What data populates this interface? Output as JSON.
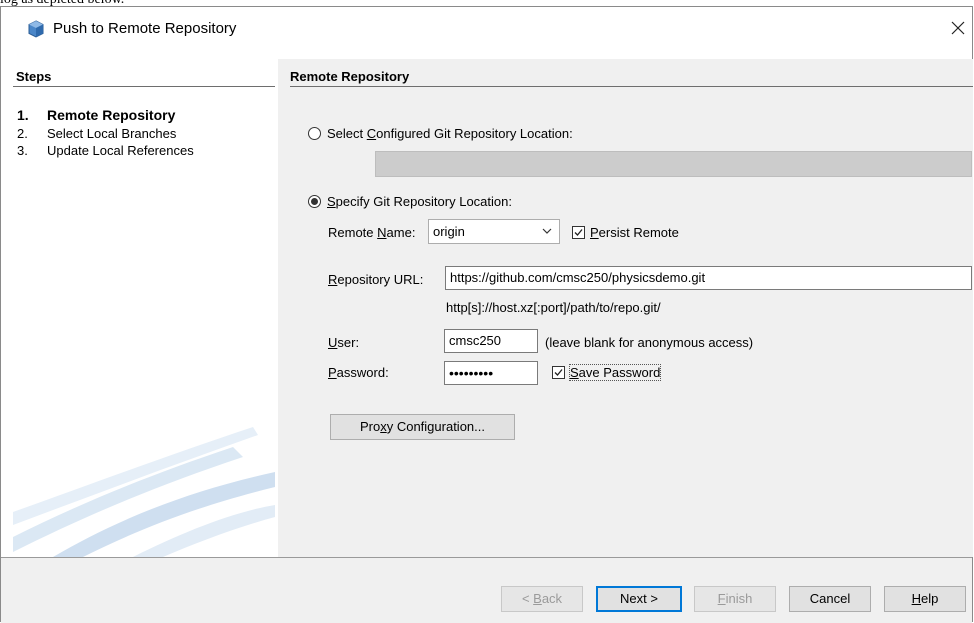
{
  "caption": "log as depicted below.",
  "window": {
    "title": "Push to Remote Repository",
    "close_glyph": "✕"
  },
  "steps": {
    "heading": "Steps",
    "items": [
      {
        "num": "1.",
        "label": "Remote Repository",
        "active": true
      },
      {
        "num": "2.",
        "label": "Select Local Branches",
        "active": false
      },
      {
        "num": "3.",
        "label": "Update Local References",
        "active": false
      }
    ]
  },
  "main": {
    "heading": "Remote Repository",
    "option_configured": {
      "pre": "Select ",
      "mnemonic": "C",
      "post": "onfigured Git Repository Location:",
      "checked": false
    },
    "option_specify": {
      "pre": "",
      "mnemonic": "S",
      "post": "pecify Git Repository Location:",
      "checked": true
    },
    "remote_name": {
      "label_pre": "Remote ",
      "label_mnemonic": "N",
      "label_post": "ame:",
      "value": "origin"
    },
    "persist_remote": {
      "mnemonic": "P",
      "post": "ersist Remote",
      "checked": true
    },
    "repository_url": {
      "label_mnemonic": "R",
      "label_post": "epository URL:",
      "value": "https://github.com/cmsc250/physicsdemo.git",
      "hint": "http[s]://host.xz[:port]/path/to/repo.git/"
    },
    "user": {
      "label_mnemonic": "U",
      "label_post": "ser:",
      "value": "cmsc250",
      "hint": "(leave blank for anonymous access)"
    },
    "password": {
      "label_mnemonic": "P",
      "label_post": "assword:",
      "value": "•••••••••"
    },
    "save_password": {
      "mnemonic": "S",
      "post": "ave Password",
      "checked": true
    },
    "proxy_button": {
      "pre": "Pro",
      "mnemonic": "x",
      "post": "y Configuration..."
    }
  },
  "footer": {
    "back": {
      "pre": "< ",
      "mnemonic": "B",
      "post": "ack",
      "enabled": false
    },
    "next": {
      "label": "Next >",
      "enabled": true
    },
    "finish": {
      "mnemonic": "F",
      "post": "inish",
      "enabled": false
    },
    "cancel": {
      "label": "Cancel",
      "enabled": true
    },
    "help": {
      "mnemonic": "H",
      "post": "elp",
      "enabled": true
    }
  },
  "colors": {
    "panel_bg": "#f0f0f0",
    "disabled_field": "#cccccc",
    "default_button_border": "#0078d7"
  }
}
